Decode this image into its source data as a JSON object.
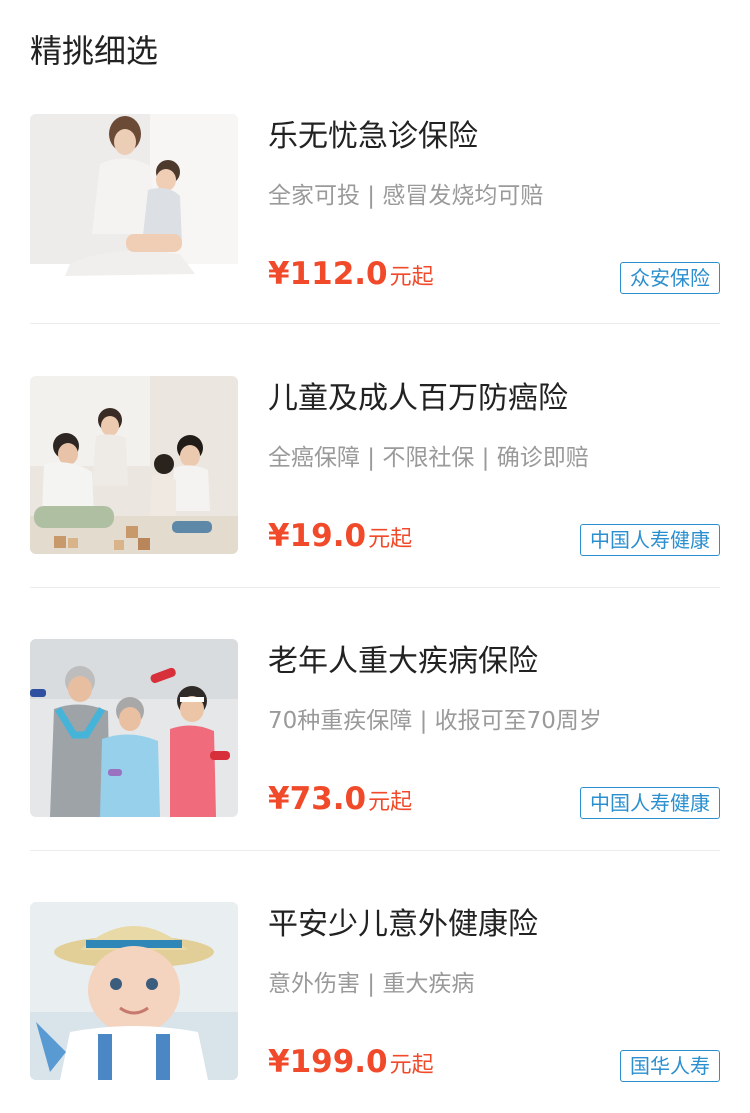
{
  "section": {
    "title": "精挑细选"
  },
  "products": [
    {
      "name": "乐无忧急诊保险",
      "tags": "全家可投 | 感冒发烧均可赔",
      "price": "¥112.0",
      "price_suffix": "元起",
      "insurer": "众安保险",
      "image_icon": "mother-child-photo"
    },
    {
      "name": "儿童及成人百万防癌险",
      "tags": "全癌保障 | 不限社保 | 确诊即赔",
      "price": "¥19.0",
      "price_suffix": "元起",
      "insurer": "中国人寿健康",
      "image_icon": "family-playing-blocks-photo"
    },
    {
      "name": "老年人重大疾病保险",
      "tags": "70种重疾保障 | 收报可至70周岁",
      "price": "¥73.0",
      "price_suffix": "元起",
      "insurer": "中国人寿健康",
      "image_icon": "seniors-exercising-photo"
    },
    {
      "name": "平安少儿意外健康险",
      "tags": "意外伤害 | 重大疾病",
      "price": "¥199.0",
      "price_suffix": "元起",
      "insurer": "国华人寿",
      "image_icon": "baby-with-hat-photo"
    }
  ],
  "colors": {
    "price": "#f04a2a",
    "insurer_badge": "#2b8fcf",
    "divider": "#ececec"
  }
}
